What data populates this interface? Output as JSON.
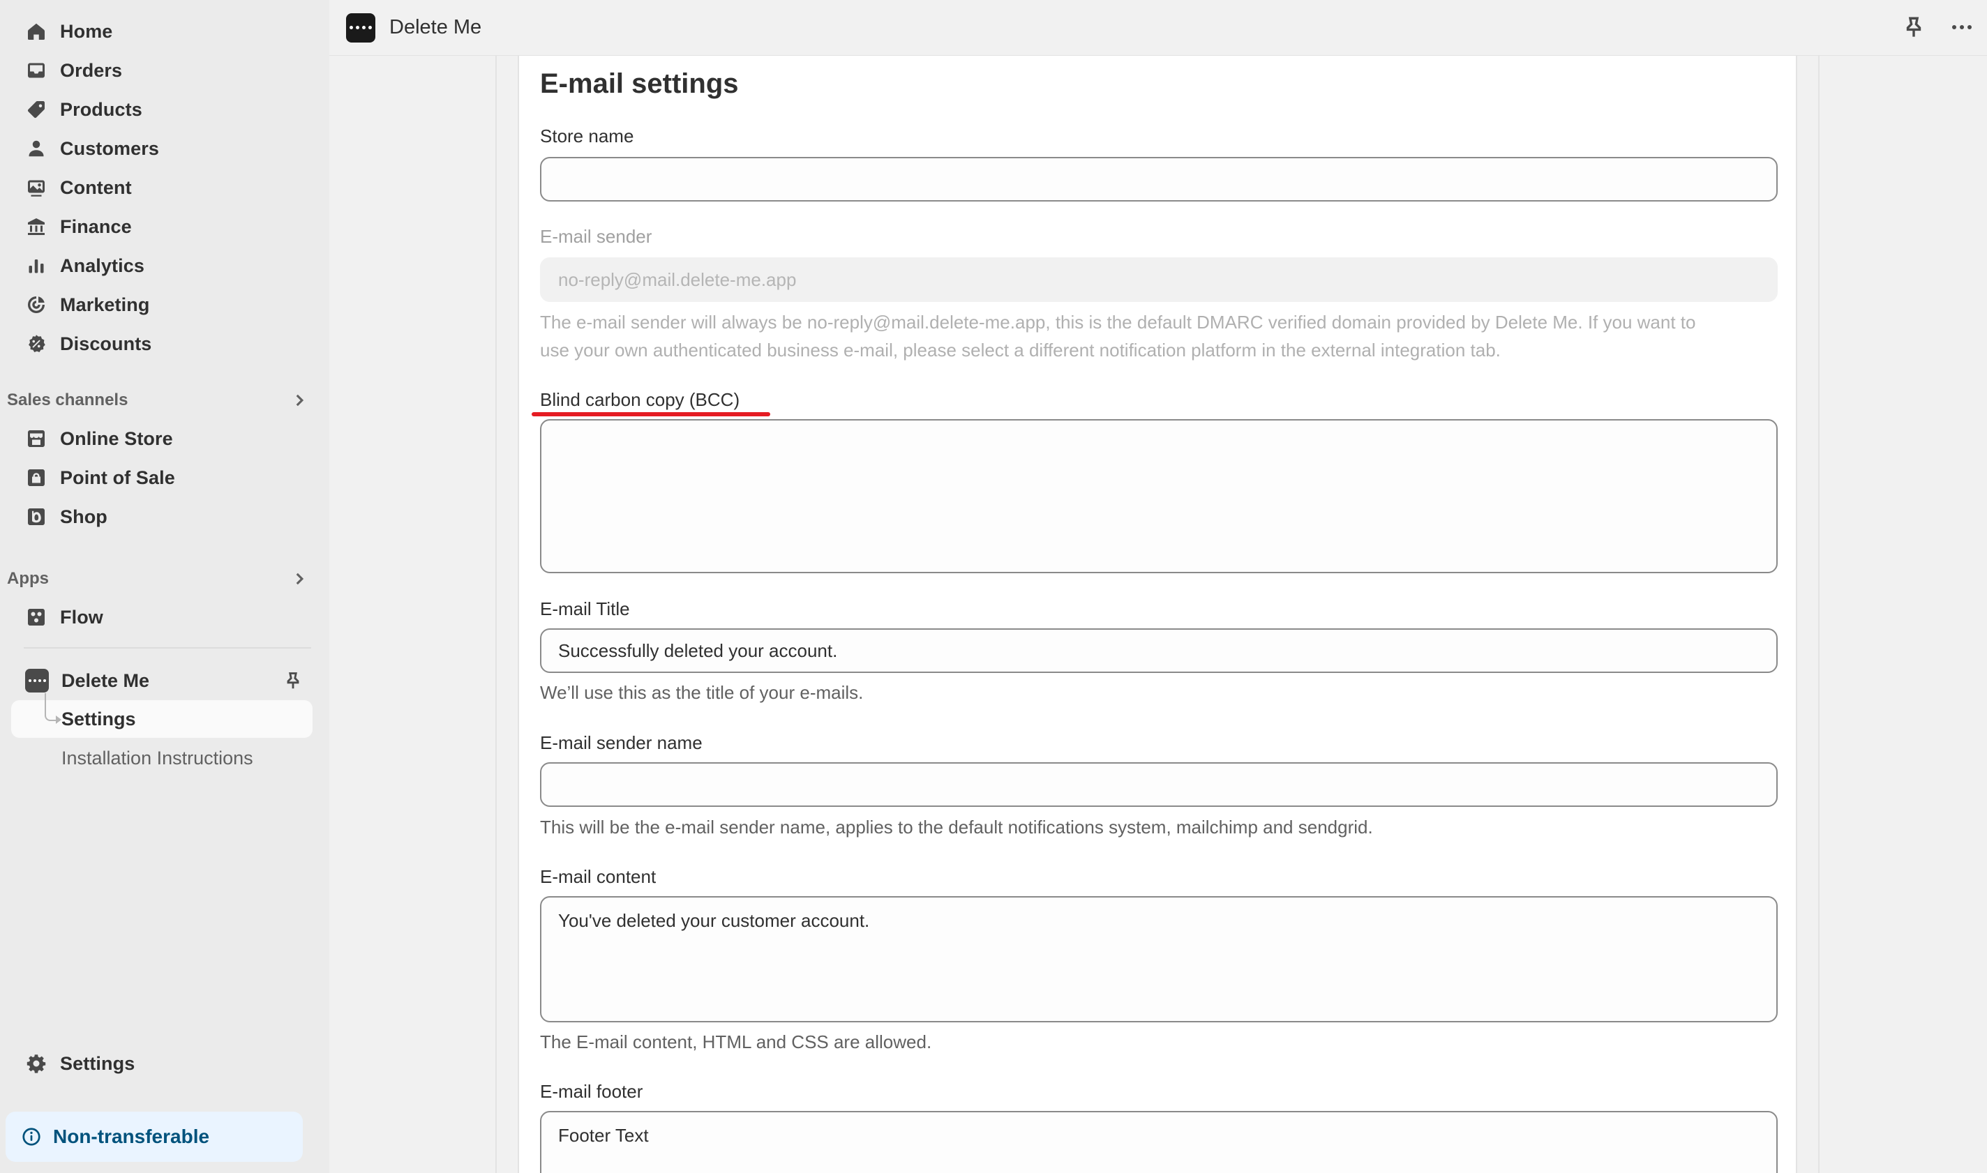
{
  "sidebar": {
    "nav": [
      {
        "label": "Home",
        "icon": "home-icon"
      },
      {
        "label": "Orders",
        "icon": "inbox-icon"
      },
      {
        "label": "Products",
        "icon": "tag-icon"
      },
      {
        "label": "Customers",
        "icon": "person-icon"
      },
      {
        "label": "Content",
        "icon": "image-icon"
      },
      {
        "label": "Finance",
        "icon": "bank-icon"
      },
      {
        "label": "Analytics",
        "icon": "bar-chart-icon"
      },
      {
        "label": "Marketing",
        "icon": "target-icon"
      },
      {
        "label": "Discounts",
        "icon": "discount-icon"
      }
    ],
    "sales_channels": {
      "title": "Sales channels",
      "items": [
        {
          "label": "Online Store",
          "icon": "store-icon"
        },
        {
          "label": "Point of Sale",
          "icon": "pos-icon"
        },
        {
          "label": "Shop",
          "icon": "shop-icon"
        }
      ]
    },
    "apps": {
      "title": "Apps",
      "items": [
        {
          "label": "Flow",
          "icon": "flow-icon"
        }
      ]
    },
    "current_app": {
      "label": "Delete Me",
      "sub_items": [
        {
          "label": "Settings"
        },
        {
          "label": "Installation Instructions"
        }
      ]
    },
    "settings_label": "Settings",
    "badge_label": "Non-transferable"
  },
  "topbar": {
    "title": "Delete Me"
  },
  "form": {
    "heading": "E-mail settings",
    "store_name": {
      "label": "Store name",
      "value": ""
    },
    "email_sender": {
      "label": "E-mail sender",
      "value": "no-reply@mail.delete-me.app",
      "help_line1": "The e-mail sender will always be no-reply@mail.delete-me.app, this is the default DMARC verified domain provided by Delete Me. If you want to",
      "help_line2": "use your own authenticated business e-mail, please select a different notification platform in the external integration tab."
    },
    "bcc": {
      "label": "Blind carbon copy (BCC)",
      "value": ""
    },
    "email_title": {
      "label": "E-mail Title",
      "value": "Successfully deleted your account.",
      "help": "We’ll use this as the title of your e-mails."
    },
    "sender_name": {
      "label": "E-mail sender name",
      "value": "",
      "help": "This will be the e-mail sender name, applies to the default notifications system, mailchimp and sendgrid."
    },
    "email_content": {
      "label": "E-mail content",
      "value": "You've deleted your customer account.",
      "help": "The E-mail content, HTML and CSS are allowed."
    },
    "email_footer": {
      "label": "E-mail footer",
      "value": "Footer Text"
    }
  },
  "colors": {
    "highlight": "#e51c23",
    "badge_bg": "#eaf4ff",
    "badge_text": "#00527c"
  }
}
